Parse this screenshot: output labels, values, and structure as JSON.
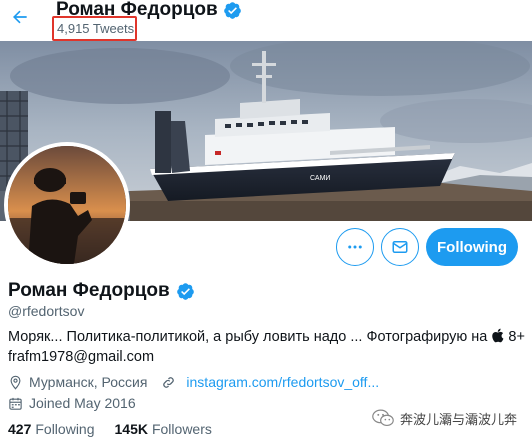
{
  "header": {
    "title": "Роман Федорцов",
    "tweets": "4,915 Tweets"
  },
  "actions": {
    "follow_label": "Following"
  },
  "profile": {
    "name": "Роман Федорцов",
    "handle": "@rfedortsov",
    "bio_line1_a": "Моряк... Политика-политикой, а рыбу ловить надо ... Фотографирую на ",
    "bio_line1_b": " 8+",
    "bio_line2": "frafm1978@gmail.com",
    "location": "Мурманск, Россия",
    "link": "instagram.com/rfedortsov_off...",
    "joined": "Joined May 2016",
    "following_count": "427",
    "following_label": "Following",
    "followers_count": "145K",
    "followers_label": "Followers"
  },
  "banner": {
    "ship_name": "САМИ"
  },
  "watermark": {
    "text": "奔波儿灞与灞波儿奔"
  },
  "colors": {
    "accent": "#1d9bf0",
    "highlight_box": "#e0352b",
    "secondary_text": "#536471"
  },
  "icons": [
    "back-arrow-icon",
    "verified-badge-icon",
    "more-icon",
    "mail-icon",
    "location-icon",
    "link-icon",
    "calendar-icon",
    "apple-icon",
    "wechat-icon"
  ]
}
